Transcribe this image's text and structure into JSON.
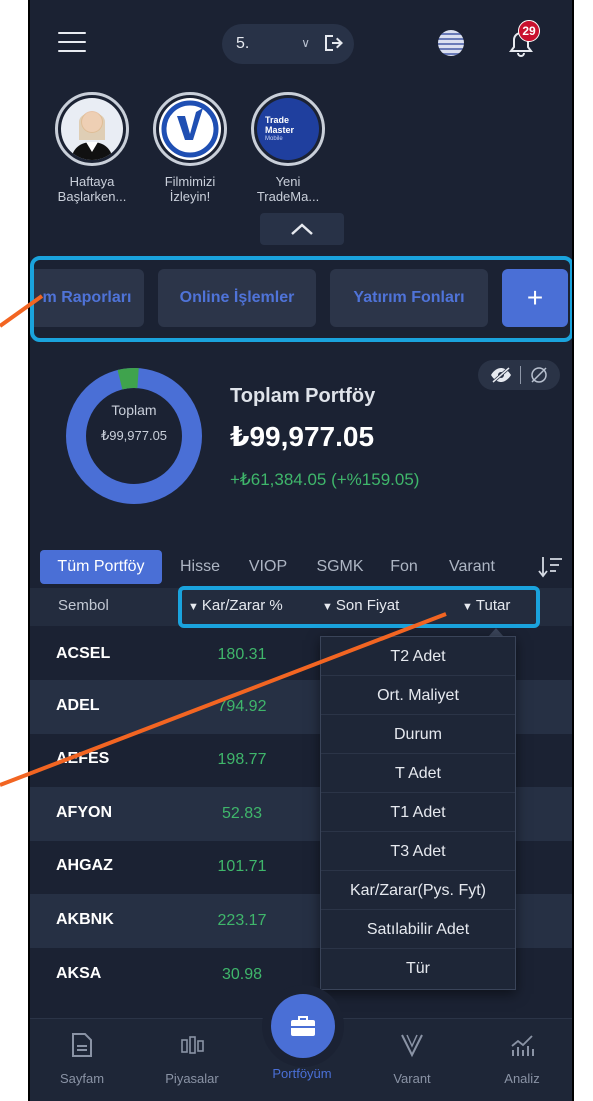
{
  "header": {
    "account_value": "5.",
    "notification_count": "29"
  },
  "stories": [
    {
      "caption": "Haftaya\nBaşlarken..."
    },
    {
      "caption": "Filmimizi\nİzleyin!"
    },
    {
      "caption": "Yeni\nTradeMa..."
    }
  ],
  "story_logo": {
    "line1": "Trade",
    "line2": "Master",
    "line3": "Mobile"
  },
  "shortcuts": [
    "m Raporları",
    "Online İşlemler",
    "Yatırım Fonları",
    "+"
  ],
  "portfolio": {
    "donut_label": "Toplam",
    "donut_value": "₺99,977.05",
    "title": "Toplam Portföy",
    "value": "₺99,977.05",
    "change": "+₺61,384.05 (+%159.05)",
    "donut_share_green": 0.05
  },
  "tabs": [
    "Tüm Portföy",
    "Hisse",
    "VIOP",
    "SGMK",
    "Fon",
    "Varant"
  ],
  "table": {
    "header": {
      "symbol": "Sembol",
      "col1": "Kar/Zarar %",
      "col2": "Son Fiyat",
      "col3": "Tutar"
    },
    "rows": [
      {
        "symbol": "ACSEL",
        "kz": "180.31"
      },
      {
        "symbol": "ADEL",
        "kz": "794.92"
      },
      {
        "symbol": "AEFES",
        "kz": "198.77"
      },
      {
        "symbol": "AFYON",
        "kz": "52.83"
      },
      {
        "symbol": "AHGAZ",
        "kz": "101.71"
      },
      {
        "symbol": "AKBNK",
        "kz": "223.17"
      },
      {
        "symbol": "AKSA",
        "kz": "30.98"
      }
    ]
  },
  "dropdown": [
    "T2 Adet",
    "Ort. Maliyet",
    "Durum",
    "T Adet",
    "T1 Adet",
    "T3 Adet",
    "Kar/Zarar(Pys. Fyt)",
    "Satılabilir Adet",
    "Tür"
  ],
  "bottom_nav": [
    "Sayfam",
    "Piyasalar",
    "Portföyüm",
    "Varant",
    "Analiz"
  ],
  "colors": {
    "accent": "#4a6fd6",
    "positive": "#3fb66b",
    "highlight": "#1aa3dd",
    "annotation": "#f26522",
    "background": "#1b2233"
  }
}
